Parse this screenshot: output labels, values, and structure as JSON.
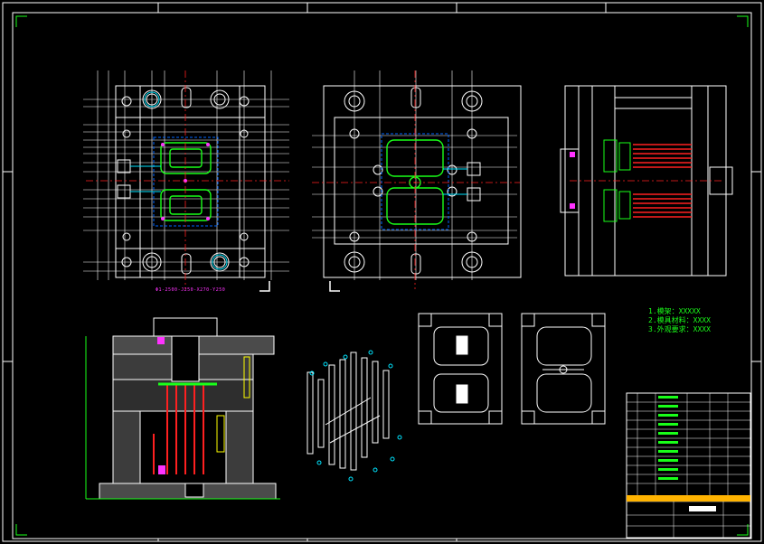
{
  "drawing": {
    "caption": "Φ1-2500-J250-X270-Y250",
    "notes": [
      "1.模架：XXXXX",
      "2.模具材料：XXXX",
      "3.外观要求：XXXX"
    ],
    "colors": {
      "background": "#000000",
      "outline": "#ffffff",
      "part": "#19ff19",
      "centerline": "#ff2020",
      "dimension": "#00e5ff",
      "accent": "#ff33ff",
      "hatch": "#c8c8c8",
      "title_block": "#ffb300"
    }
  }
}
